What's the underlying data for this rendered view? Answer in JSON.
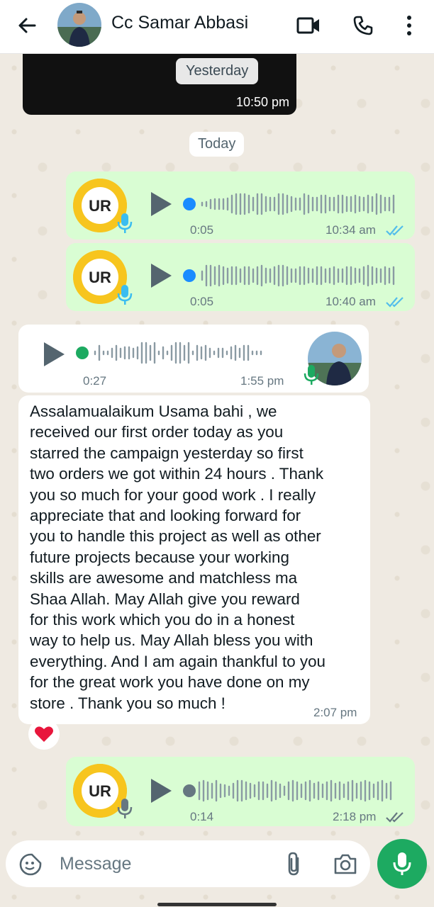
{
  "header": {
    "contact_name": "Cc Samar Abbasi",
    "icons": [
      "back-arrow-icon",
      "video-call-icon",
      "phone-icon",
      "more-vertical-icon"
    ]
  },
  "messages": {
    "prev_media": {
      "badge": "Yesterday",
      "time": "10:50 pm"
    },
    "date_divider": "Today",
    "voice_1": {
      "duration": "0:05",
      "time": "10:34 am",
      "status": "read"
    },
    "voice_2": {
      "duration": "0:05",
      "time": "10:40 am",
      "status": "read"
    },
    "voice_in": {
      "duration": "0:27",
      "time": "1:55 pm"
    },
    "text_in": {
      "text": "Assalamualaikum Usama bahi ,  we\nreceived our first order today as  you\nstarred the campaign yesterday so first\ntwo orders we got within 24 hours . Thank\nyou so much for your good work . I really\nappreciate that and looking forward for\nyou to handle this project as well as other\nfuture projects because your working\nskills are awesome and matchless ma\nShaa Allah. May Allah give you reward\nfor this work  which you do in a honest\nway to help us. May Allah bless you with\neverything. And I am again thankful to you\nfor the great work you have done on my\nstore . Thank you so much !",
      "time": "2:07 pm",
      "reaction": "❤️"
    },
    "voice_3": {
      "duration": "0:14",
      "time": "2:18 pm",
      "status": "delivered"
    }
  },
  "input": {
    "placeholder": "Message"
  },
  "colors": {
    "outgoing_bubble": "#d9fdd3",
    "incoming_bubble": "#ffffff",
    "read_tick": "#53bdeb",
    "accent_green": "#1daa61"
  }
}
